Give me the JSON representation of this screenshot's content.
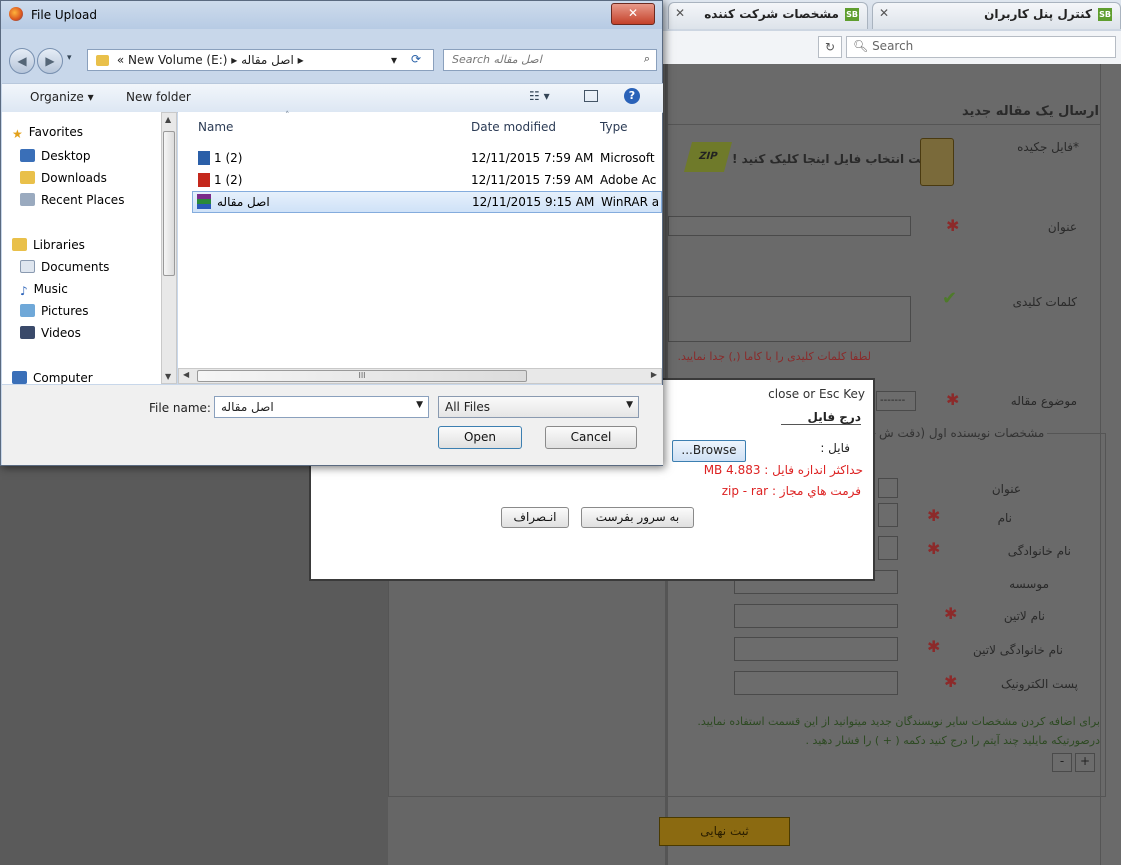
{
  "browser": {
    "tabs": [
      {
        "label": "مشخصات شرکت کننده"
      },
      {
        "label": "کنترل پنل کاربران"
      }
    ],
    "search_placeholder": "Search",
    "reload_icon": "reload-icon"
  },
  "page": {
    "heading": "ارسال یک مقاله جدید",
    "fields": {
      "file_label": "*فایل جکیده",
      "file_hint": "جهت انتخاب فایل اینجا کلیک کنید !",
      "zip_badge": "ZIP",
      "title_label": "عنوان",
      "keywords_label": "کلمات کلیدی",
      "keywords_hint": "لطفا کلمات کلیدی را با کاما (,) جدا نمایید.",
      "topic_label": "موضوع مقاله",
      "topic_value": "-------",
      "author_legend": "مشخصات نویسنده اول (دقت ش",
      "author_title_label": "عنوان",
      "name_label": "نام",
      "family_label": "نام خانوادگی",
      "institute_label": "موسسه",
      "latin_name_label": "نام لاتین",
      "latin_family_label": "نام خانوادگی لاتین",
      "email_label": "پست الکترونیک",
      "add_authors_note": "برای اضافه کردن مشخصات سایر نویسندگان جدید میتوانید از این قسمت استفاده نمایید. درصورتیکه مایلید چند آیتم را درج کنید دکمه ( + ) را فشار دهید .",
      "plus": "+",
      "minus": "-",
      "submit": "ثبت نهایی"
    }
  },
  "dialog": {
    "close_text": "close or Esc Key",
    "title": "درج فایل",
    "file_label": "فایل :",
    "browse": "...Browse",
    "max_size": "حداکثر اندازه فایل : 4.883 MB",
    "formats": "فرمت هاي مجاز : zip - rar",
    "send_button": "به سرور بفرست",
    "cancel_button": "انـصراف"
  },
  "file_upload": {
    "title": "File Upload",
    "address": {
      "prefix": "«",
      "volume": "New Volume (E:)",
      "sep": "▸",
      "folder": "اصل مقاله",
      "sep2": "▸"
    },
    "search_placeholder": "Search اصل مقاله",
    "toolbar": {
      "organize": "Organize ▾",
      "new_folder": "New folder"
    },
    "nav": {
      "favorites": "Favorites",
      "desktop": "Desktop",
      "downloads": "Downloads",
      "recent": "Recent Places",
      "libraries": "Libraries",
      "documents": "Documents",
      "music": "Music",
      "pictures": "Pictures",
      "videos": "Videos",
      "computer": "Computer"
    },
    "columns": {
      "name": "Name",
      "date": "Date modified",
      "type": "Type"
    },
    "files": [
      {
        "name": "1 (2)",
        "date": "12/11/2015 7:59 AM",
        "type": "Microsoft",
        "icon": "word-doc-icon",
        "color": "#2b5fa8"
      },
      {
        "name": "1 (2)",
        "date": "12/11/2015 7:59 AM",
        "type": "Adobe Ac",
        "icon": "pdf-icon",
        "color": "#c4281c"
      },
      {
        "name": "اصل مقاله",
        "date": "12/11/2015 9:15 AM",
        "type": "WinRAR a",
        "icon": "winrar-archive-icon",
        "color": "#7a2c8a"
      }
    ],
    "file_name_label": "File name:",
    "file_name_value": "اصل مقاله",
    "filter_value": "All Files",
    "open_button": "Open",
    "cancel_button": "Cancel",
    "scroll_glyph": "III"
  }
}
